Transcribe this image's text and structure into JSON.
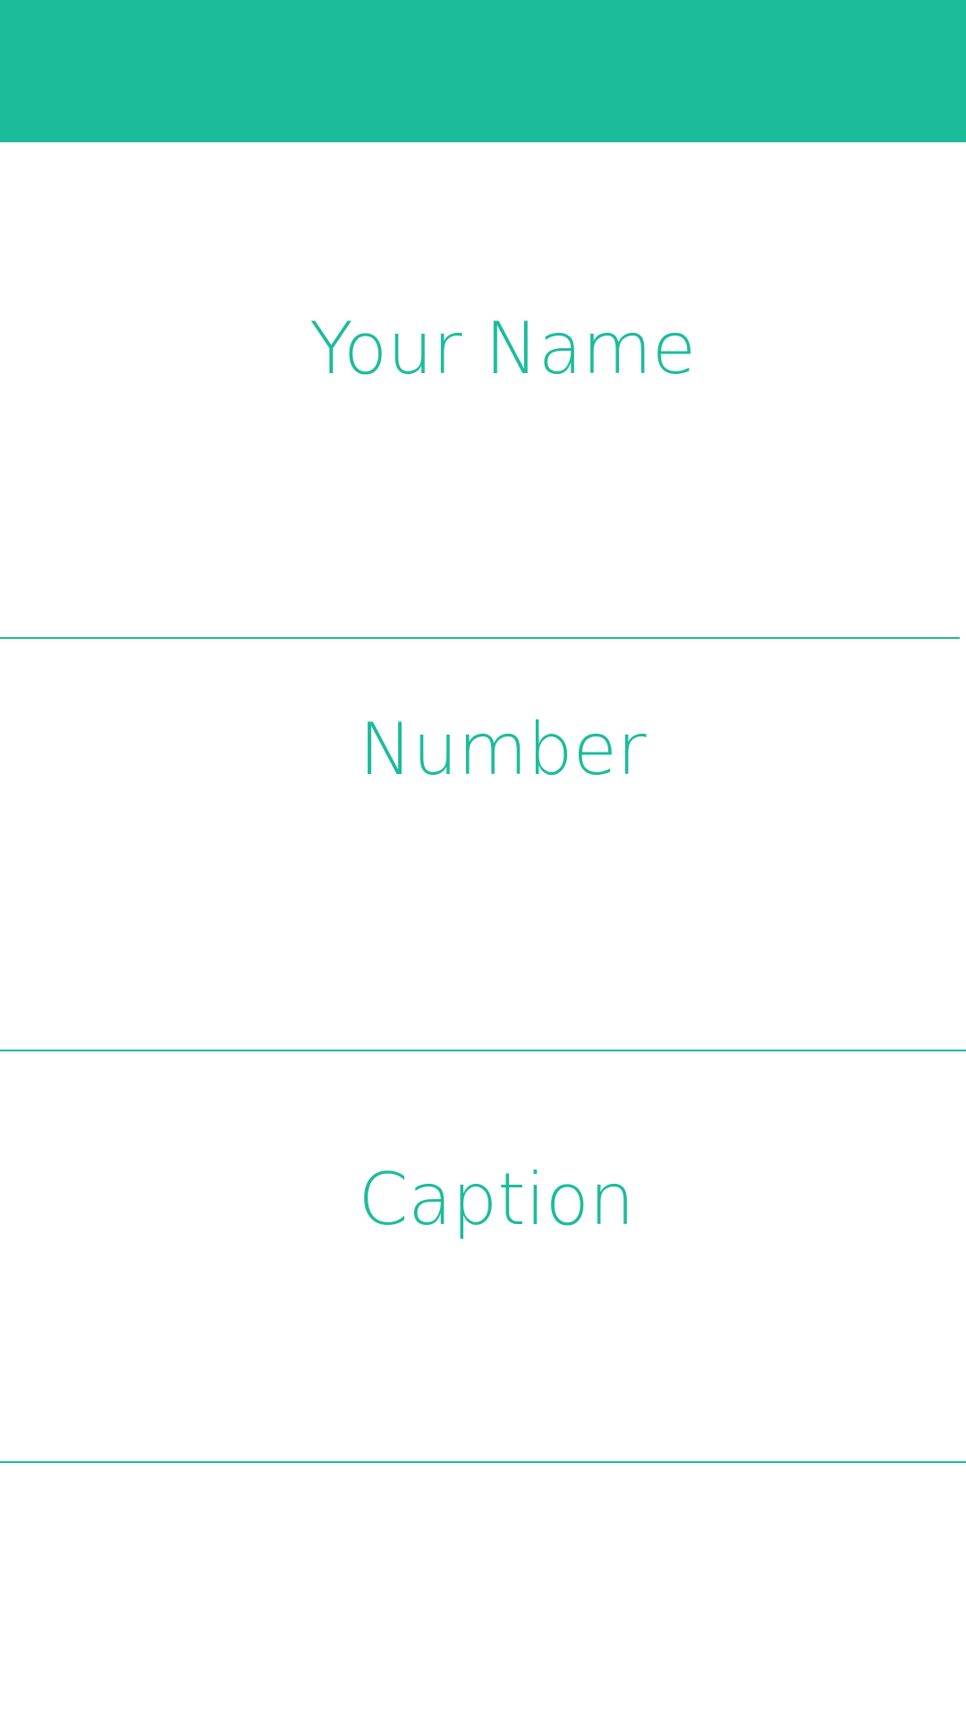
{
  "app_bar": {
    "color": "#1cbc9b"
  },
  "form": {
    "name_field": {
      "placeholder": "Your Name"
    },
    "number_field": {
      "placeholder": "Number"
    },
    "caption_field": {
      "placeholder": "Caption"
    }
  }
}
